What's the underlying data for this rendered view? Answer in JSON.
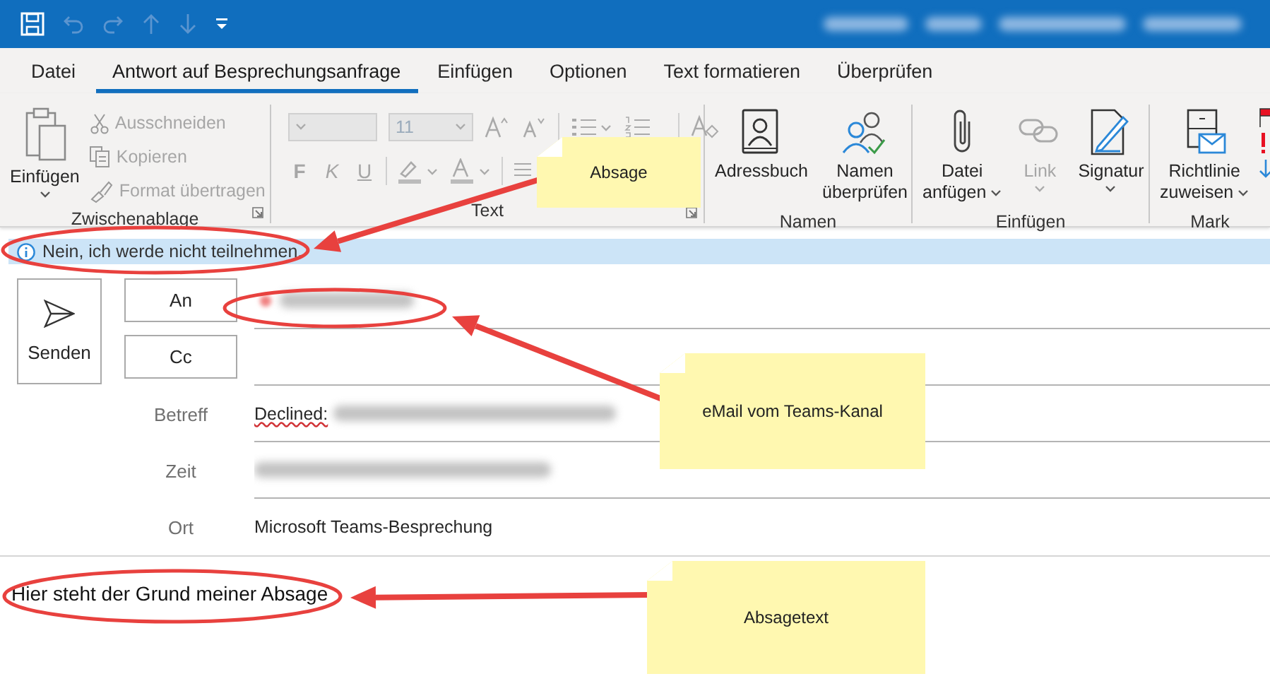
{
  "title_bar": {
    "title_blurred": true
  },
  "tabs": [
    {
      "label": "Datei",
      "selected": false
    },
    {
      "label": "Antwort auf Besprechungsanfrage",
      "selected": true
    },
    {
      "label": "Einfügen",
      "selected": false
    },
    {
      "label": "Optionen",
      "selected": false
    },
    {
      "label": "Text formatieren",
      "selected": false
    },
    {
      "label": "Überprüfen",
      "selected": false
    }
  ],
  "ribbon": {
    "groups": [
      {
        "kind": "clipboard",
        "label": "Zwischenablage",
        "launcher": true,
        "paste": {
          "label": "Einfügen",
          "dropdown": true,
          "disabled": false
        },
        "commands": [
          {
            "label": "Ausschneiden",
            "disabled": true
          },
          {
            "label": "Kopieren",
            "disabled": true
          },
          {
            "label": "Format übertragen",
            "disabled": true
          }
        ]
      },
      {
        "kind": "text",
        "label": "Text",
        "launcher": true,
        "font_size": "11",
        "format_buttons": [
          "F",
          "K",
          "U"
        ]
      },
      {
        "kind": "buttons",
        "label": "Namen",
        "commands": [
          {
            "label": "Adressbuch",
            "disabled": false
          },
          {
            "label": "Namen überprüfen",
            "disabled": false
          }
        ]
      },
      {
        "kind": "buttons",
        "label": "Einfügen",
        "commands": [
          {
            "label": "Datei anfügen",
            "dropdown": true,
            "disabled": false
          },
          {
            "label": "Link",
            "dropdown": true,
            "disabled": true
          },
          {
            "label": "Signatur",
            "dropdown": true,
            "disabled": false
          }
        ]
      },
      {
        "kind": "buttons",
        "label": "Mark",
        "commands": [
          {
            "label": "Richtlinie zuweisen",
            "dropdown": true,
            "disabled": false
          }
        ]
      }
    ]
  },
  "info_bar": {
    "text": "Nein, ich werde nicht teilnehmen."
  },
  "compose": {
    "send_button": "Senden",
    "recipients": [
      {
        "button": "An",
        "blurred": true
      },
      {
        "button": "Cc"
      }
    ],
    "fields": [
      {
        "label": "Betreff",
        "value": "Declined:",
        "misspelled": true,
        "blurred": true
      },
      {
        "label": "Zeit",
        "blurred": true
      },
      {
        "label": "Ort",
        "value": "Microsoft Teams-Besprechung"
      }
    ]
  },
  "body": {
    "text": "Hier steht der Grund meiner Absage"
  },
  "notes": [
    {
      "text": "Absage"
    },
    {
      "text": "eMail vom Teams-Kanal"
    },
    {
      "text": "Absagetext"
    }
  ]
}
